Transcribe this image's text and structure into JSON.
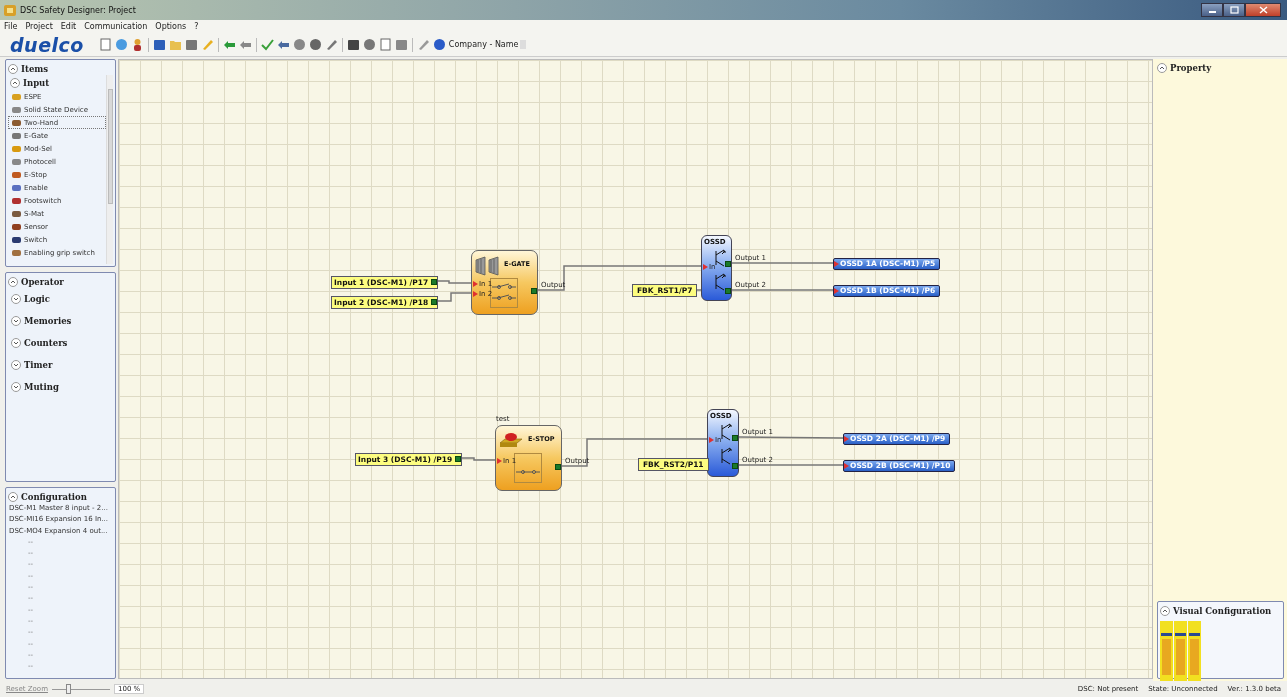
{
  "window": {
    "title": "DSC Safety Designer: Project"
  },
  "menu": [
    "File",
    "Project",
    "Edit",
    "Communication",
    "Options",
    "?"
  ],
  "toolbar": {
    "logo": "duelco",
    "company_field": "Company - Name"
  },
  "items_panel": {
    "title": "Items",
    "expanded": true,
    "group": {
      "title": "Input",
      "expanded": true,
      "items": [
        {
          "label": "ESPE",
          "selected": false
        },
        {
          "label": "Solid State Device",
          "selected": false
        },
        {
          "label": "Two-Hand",
          "selected": true
        },
        {
          "label": "E-Gate",
          "selected": false
        },
        {
          "label": "Mod-Sel",
          "selected": false
        },
        {
          "label": "Photocell",
          "selected": false
        },
        {
          "label": "E-Stop",
          "selected": false
        },
        {
          "label": "Enable",
          "selected": false
        },
        {
          "label": "Footswitch",
          "selected": false
        },
        {
          "label": "S-Mat",
          "selected": false
        },
        {
          "label": "Sensor",
          "selected": false
        },
        {
          "label": "Switch",
          "selected": false
        },
        {
          "label": "Enabling grip switch",
          "selected": false
        }
      ]
    }
  },
  "operator_panel": {
    "title": "Operator",
    "expanded": true,
    "groups": [
      {
        "title": "Logic",
        "expanded": false
      },
      {
        "title": "Memories",
        "expanded": false
      },
      {
        "title": "Counters",
        "expanded": false
      },
      {
        "title": "Timer",
        "expanded": false
      },
      {
        "title": "Muting",
        "expanded": false
      }
    ]
  },
  "configuration_panel": {
    "title": "Configuration",
    "expanded": true,
    "modules": [
      "DSC-M1 Master 8 input - 2...",
      "DSC-MI16 Expansion 16 In...",
      "DSC-MO4 Expansion 4 out..."
    ],
    "empty_slots": [
      "--",
      "--",
      "--",
      "--",
      "--",
      "--",
      "--",
      "--",
      "--",
      "--",
      "--",
      "--"
    ]
  },
  "diagram": {
    "circuits": [
      {
        "inputs": [
          "Input 1 (DSC-M1) /P17",
          "Input 2 (DSC-M1) /P18"
        ],
        "function": {
          "kind": "e-gate",
          "title": "E-GATE",
          "input_ports": [
            "In 1",
            "In 2"
          ],
          "output_port": "Output"
        },
        "ossd": {
          "title": "OSSD",
          "input_port": "In",
          "output_ports": [
            "Output 1",
            "Output 2"
          ]
        },
        "feedback": "FBK_RST1/P7",
        "outputs": [
          "OSSD 1A (DSC-M1) /P5",
          "OSSD 1B (DSC-M1) /P6"
        ]
      },
      {
        "caption": "test",
        "inputs": [
          "Input 3 (DSC-M1) /P19"
        ],
        "function": {
          "kind": "e-stop",
          "title": "E-STOP",
          "input_ports": [
            "In 1"
          ],
          "output_port": "Output"
        },
        "ossd": {
          "title": "OSSD",
          "input_port": "In",
          "output_ports": [
            "Output 1",
            "Output 2"
          ]
        },
        "feedback": "FBK_RST2/P11",
        "outputs": [
          "OSSD 2A (DSC-M1) /P9",
          "OSSD 2B (DSC-M1) /P10"
        ]
      }
    ]
  },
  "property_panel": {
    "title": "Property",
    "expanded": true
  },
  "visual_configuration": {
    "title": "Visual Configuration",
    "expanded": true
  },
  "zoom": {
    "reset": "Reset Zoom",
    "level": 0.3,
    "reading": "100 %"
  },
  "status_bar": {
    "dsc": "DSC: Not present",
    "state": "State: Unconnected",
    "version": "Ver.: 1.3.0 beta"
  }
}
